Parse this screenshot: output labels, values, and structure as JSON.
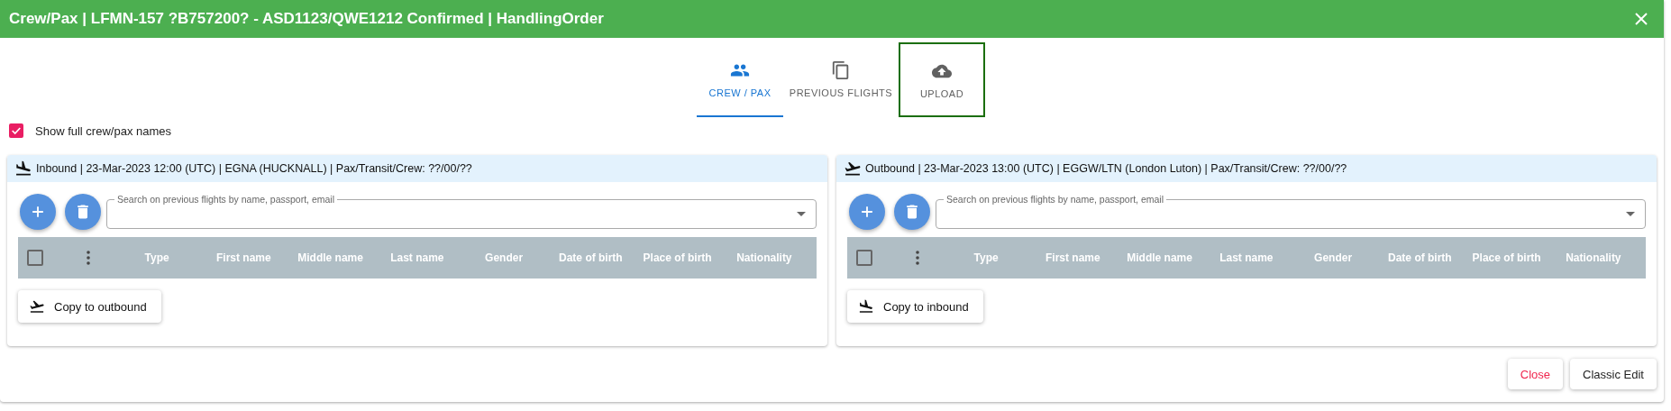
{
  "dialog": {
    "title": "Crew/Pax | LFMN-157 ?B757200? - ASD1123/QWE1212 Confirmed | HandlingOrder"
  },
  "tabs": [
    {
      "label": "CREW / PAX",
      "kind": "people",
      "selected": true,
      "focused": false
    },
    {
      "label": "PREVIOUS FLIGHTS",
      "kind": "copy",
      "selected": false,
      "focused": false
    },
    {
      "label": "UPLOAD",
      "kind": "upload",
      "selected": false,
      "focused": true
    }
  ],
  "show_full_names": {
    "label": "Show full crew/pax names",
    "checked": true
  },
  "panels": [
    {
      "kind": "arrival",
      "header": "Inbound | 23-Mar-2023 12:00 (UTC) | EGNA (HUCKNALL) | Pax/Transit/Crew: ??/00/??",
      "search_label": "Search on previous flights by name, passport, email",
      "select_all": {
        "checked": false
      },
      "columns": [
        "Type",
        "First name",
        "Middle name",
        "Last name",
        "Gender",
        "Date of birth",
        "Place of birth",
        "Nationality"
      ],
      "copy_button": "Copy to outbound"
    },
    {
      "kind": "departure",
      "header": "Outbound | 23-Mar-2023 13:00 (UTC) | EGGW/LTN (London Luton) | Pax/Transit/Crew: ??/00/??",
      "search_label": "Search on previous flights by name, passport, email",
      "select_all": {
        "checked": false
      },
      "columns": [
        "Type",
        "First name",
        "Middle name",
        "Last name",
        "Gender",
        "Date of birth",
        "Place of birth",
        "Nationality"
      ],
      "copy_button": "Copy to inbound"
    }
  ],
  "buttons": [
    {
      "label": "Close",
      "kind": "danger"
    },
    {
      "label": "Classic Edit",
      "kind": "normal"
    }
  ]
}
